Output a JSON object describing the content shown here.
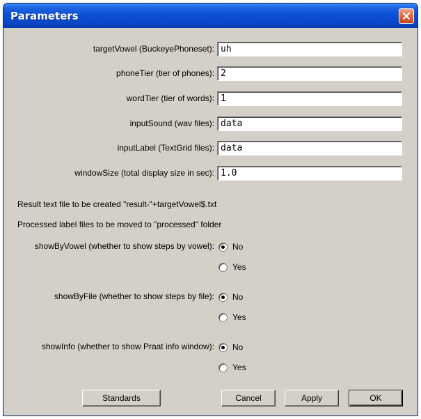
{
  "window": {
    "title": "Parameters"
  },
  "fields": [
    {
      "label": "targetVowel (BuckeyePhoneset):",
      "value": "uh"
    },
    {
      "label": "phoneTier (tier of phones):",
      "value": "2"
    },
    {
      "label": "wordTier (tier of words):",
      "value": "1"
    },
    {
      "label": "inputSound (wav files):",
      "value": "data"
    },
    {
      "label": "inputLabel (TextGrid files):",
      "value": "data"
    },
    {
      "label": "windowSize (total display size in sec):",
      "value": "1.0"
    }
  ],
  "info": {
    "line1": "Result text file to be created \"result-\"+targetVowel$.txt",
    "line2": "Processed label files to be moved to \"processed\" folder"
  },
  "radio_groups": [
    {
      "label": "showByVowel (whether to show steps by vowel):",
      "options": [
        "No",
        "Yes"
      ],
      "selected": "No"
    },
    {
      "label": "showByFile (whether to show steps by file):",
      "options": [
        "No",
        "Yes"
      ],
      "selected": "No"
    },
    {
      "label": "showInfo (whether to show Praat info window):",
      "options": [
        "No",
        "Yes"
      ],
      "selected": "No"
    }
  ],
  "buttons": {
    "standards": "Standards",
    "cancel": "Cancel",
    "apply": "Apply",
    "ok": "OK"
  },
  "icons": {
    "close": "close-icon"
  },
  "colors": {
    "titlebar": "#0a4fd4",
    "close_button": "#e26a3f",
    "dialog_background": "#d4d0c8"
  }
}
